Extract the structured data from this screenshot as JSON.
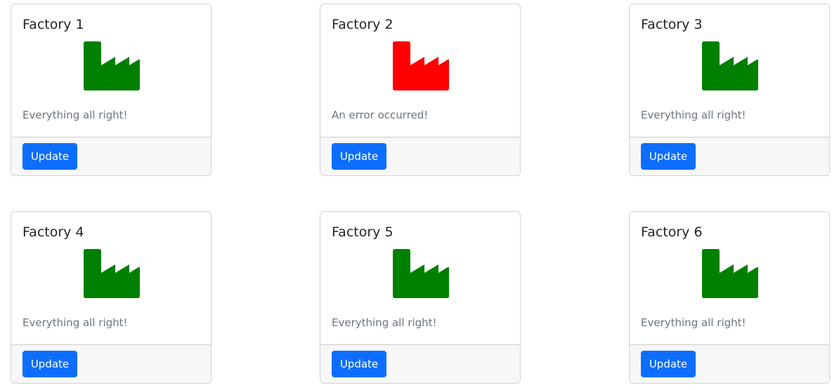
{
  "factories": [
    {
      "title": "Factory 1",
      "status": "Everything all right!",
      "icon": "factory-icon",
      "icon_color": "#008000",
      "button": "Update"
    },
    {
      "title": "Factory 2",
      "status": "An error occurred!",
      "icon": "factory-icon",
      "icon_color": "#ff0000",
      "button": "Update"
    },
    {
      "title": "Factory 3",
      "status": "Everything all right!",
      "icon": "factory-icon",
      "icon_color": "#008000",
      "button": "Update"
    },
    {
      "title": "Factory 4",
      "status": "Everything all right!",
      "icon": "factory-icon",
      "icon_color": "#008000",
      "button": "Update"
    },
    {
      "title": "Factory 5",
      "status": "Everything all right!",
      "icon": "factory-icon",
      "icon_color": "#008000",
      "button": "Update"
    },
    {
      "title": "Factory 6",
      "status": "Everything all right!",
      "icon": "factory-icon",
      "icon_color": "#008000",
      "button": "Update"
    }
  ]
}
